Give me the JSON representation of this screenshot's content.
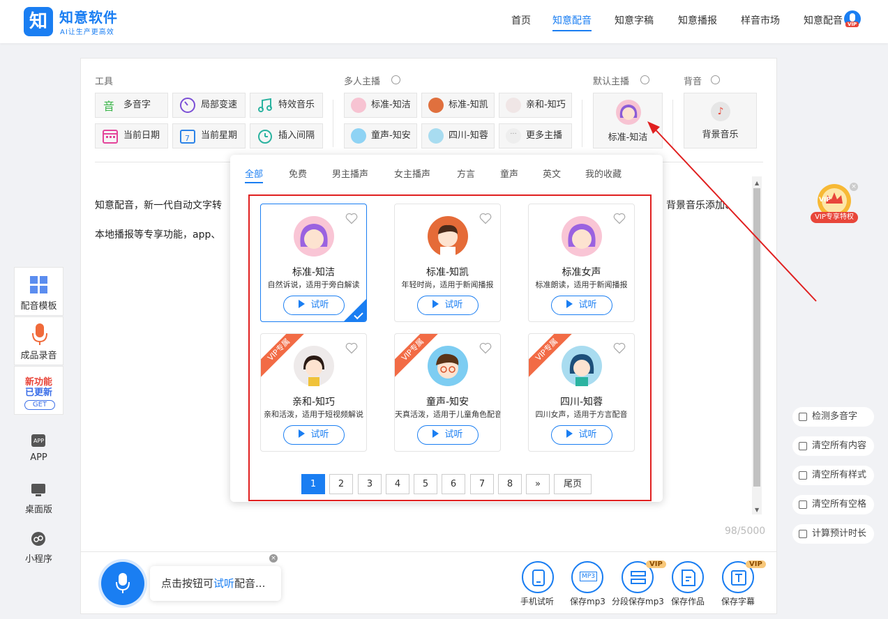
{
  "header": {
    "brand": "知意软件",
    "slogan": "AI让生产更高效",
    "nav": [
      "首页",
      "知意配音",
      "知意字稿",
      "知意播报",
      "样音市场",
      "知意配音"
    ],
    "vip_mark": "VIP"
  },
  "tools": {
    "title": "工具",
    "items": [
      "多音字",
      "局部变速",
      "特效音乐",
      "当前日期",
      "当前星期",
      "插入间隔"
    ]
  },
  "multi": {
    "title": "多人主播",
    "items": [
      "标准-知洁",
      "标准-知凯",
      "亲和-知巧",
      "童声-知安",
      "四川-知蓉",
      "更多主播"
    ]
  },
  "default_anchor": {
    "title": "默认主播",
    "name": "标准-知洁"
  },
  "bgm": {
    "title": "背音",
    "label": "背景音乐"
  },
  "editor": {
    "line1_start": "知意配音，新一代自动文字转",
    "line1_end": "背景音乐添加、",
    "line2": "本地播报等专享功能，app、",
    "count": "98/5000"
  },
  "popup": {
    "tabs": [
      "全部",
      "免费",
      "男主播声",
      "女主播声",
      "方言",
      "童声",
      "英文",
      "我的收藏"
    ],
    "vip_ribbon": "VIP专属",
    "play_label": "试听",
    "cards": [
      {
        "name": "标准-知洁",
        "desc": "自然诉说，适用于旁白解读"
      },
      {
        "name": "标准-知凯",
        "desc": "年轻时尚，适用于新闻播报"
      },
      {
        "name": "标准女声",
        "desc": "标准朗读，适用于新闻播报"
      },
      {
        "name": "亲和-知巧",
        "desc": "亲和活泼，适用于短视频解说"
      },
      {
        "name": "童声-知安",
        "desc": "天真活泼，适用于儿童角色配音"
      },
      {
        "name": "四川-知蓉",
        "desc": "四川女声，适用于方言配音"
      }
    ],
    "pages": [
      "1",
      "2",
      "3",
      "4",
      "5",
      "6",
      "7",
      "8",
      "»",
      "尾页"
    ]
  },
  "left_sidebar": {
    "template": "配音模板",
    "record": "成品录音",
    "new1": "新功能",
    "new2": "已更新",
    "get": "GET",
    "app": "APP",
    "desktop": "桌面版",
    "mini": "小程序"
  },
  "vip_promo": {
    "label": "VIP专享特权",
    "badge": "VIP"
  },
  "right_buttons": [
    "检测多音字",
    "清空所有内容",
    "清空所有样式",
    "清空所有空格",
    "计算预计时长"
  ],
  "bottom": {
    "tip_prefix": "点击按钮可",
    "tip_highlight": "试听",
    "tip_suffix": "配音...",
    "actions": [
      "手机试听",
      "保存mp3",
      "分段保存mp3",
      "保存作品",
      "保存字幕"
    ],
    "vip": "VIP",
    "mp3": "MP3"
  }
}
